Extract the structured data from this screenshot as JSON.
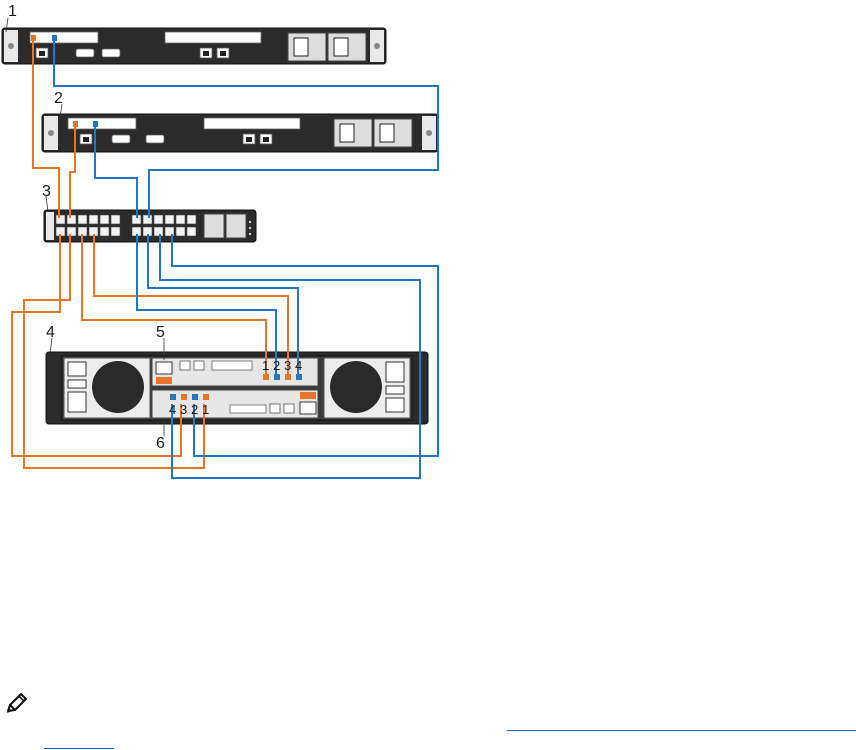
{
  "callouts": {
    "c1": "1",
    "c2": "2",
    "c3": "3",
    "c4": "4",
    "c5": "5",
    "c6": "6"
  },
  "upper_controller_ports": [
    "1",
    "2",
    "3",
    "4"
  ],
  "lower_controller_ports": [
    "4",
    "3",
    "2",
    "1"
  ],
  "colors": {
    "fabric_a": "#e8742a",
    "fabric_b": "#1f78c1",
    "chassis": "#2b2b2b"
  },
  "icons": {
    "note": "pencil-note-icon"
  }
}
